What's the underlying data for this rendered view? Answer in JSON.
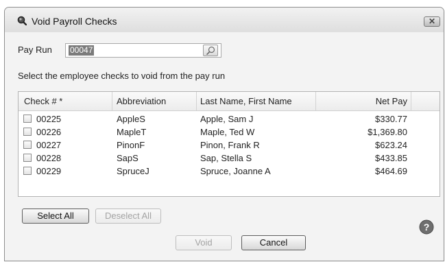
{
  "window": {
    "title": "Void Payroll Checks",
    "close_label": "✕"
  },
  "pay_run": {
    "label": "Pay Run",
    "value": "00047"
  },
  "instruction": "Select the employee checks to void from the pay run",
  "table": {
    "headers": [
      "Check # *",
      "Abbreviation",
      "Last Name, First Name",
      "Net Pay"
    ],
    "rows": [
      {
        "check": "00225",
        "abbreviation": "AppleS",
        "name": "Apple, Sam J",
        "net_pay": "$330.77",
        "checked": false
      },
      {
        "check": "00226",
        "abbreviation": "MapleT",
        "name": "Maple, Ted W",
        "net_pay": "$1,369.80",
        "checked": false
      },
      {
        "check": "00227",
        "abbreviation": "PinonF",
        "name": "Pinon, Frank R",
        "net_pay": "$623.24",
        "checked": false
      },
      {
        "check": "00228",
        "abbreviation": "SapS",
        "name": "Sap, Stella S",
        "net_pay": "$433.85",
        "checked": false
      },
      {
        "check": "00229",
        "abbreviation": "SpruceJ",
        "name": "Spruce, Joanne A",
        "net_pay": "$464.69",
        "checked": false
      }
    ]
  },
  "buttons": {
    "select_all": "Select All",
    "deselect_all": "Deselect All",
    "void": "Void",
    "cancel": "Cancel"
  },
  "icons": {
    "app": "magnifier-app-icon",
    "search": "search-icon",
    "help": "help-icon",
    "close": "close-icon"
  },
  "colors": {
    "selection": "#7b7b7b",
    "window_bg": "#f3f3f3"
  }
}
